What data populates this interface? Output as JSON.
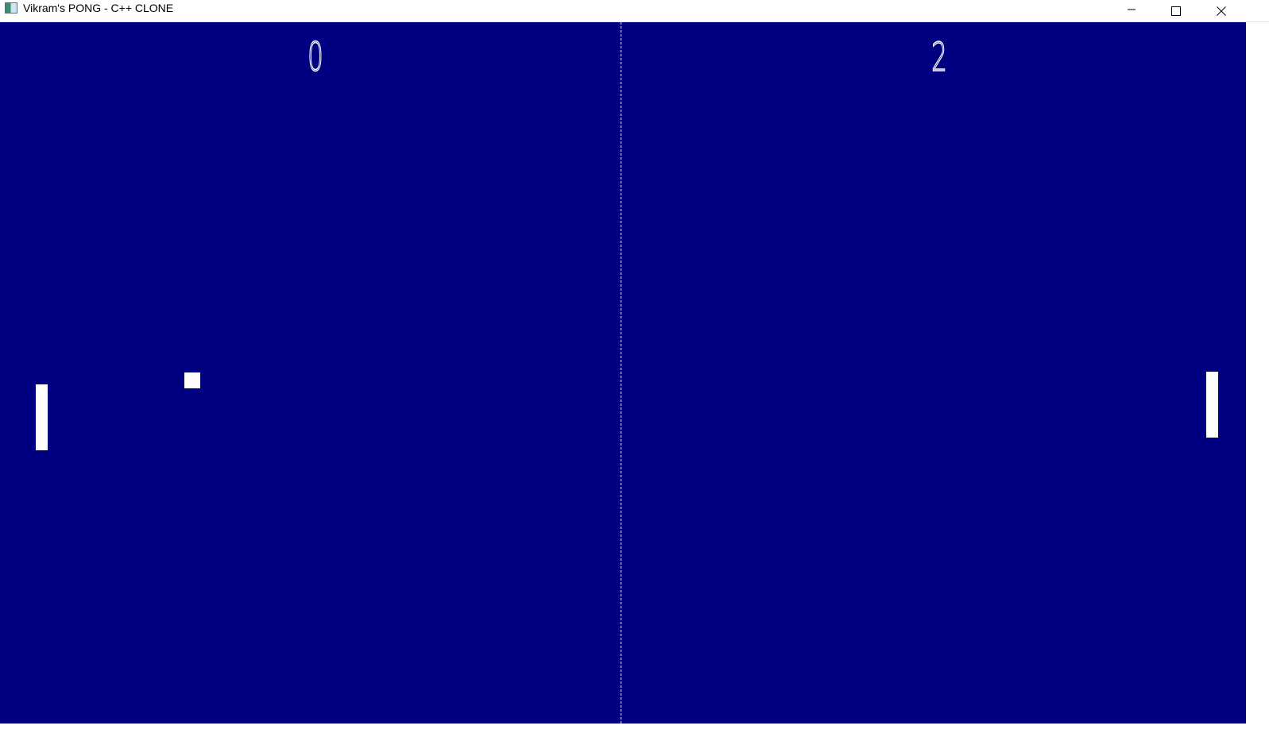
{
  "window": {
    "title": "Vikram's PONG - C++ CLONE",
    "icon": "app-window-icon",
    "controls": {
      "minimize_icon": "minimize-icon",
      "maximize_icon": "maximize-icon",
      "close_icon": "close-icon"
    }
  },
  "game": {
    "background_color": "#000080",
    "foreground_color": "#ffffff",
    "scores": {
      "left": "0",
      "right": "2"
    }
  }
}
